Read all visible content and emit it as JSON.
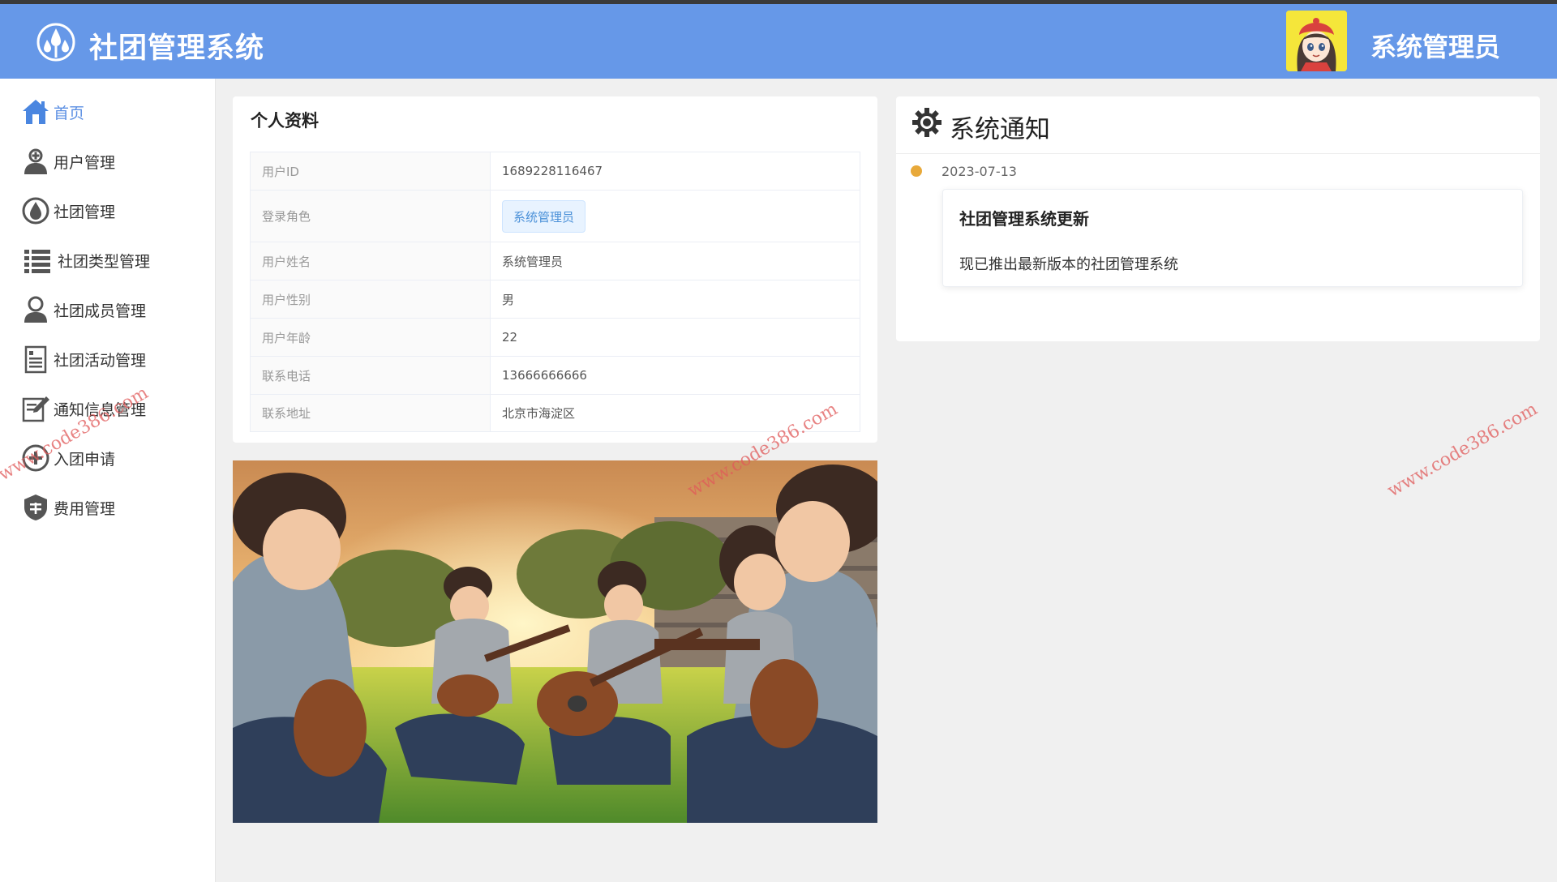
{
  "header": {
    "app_title": "社团管理系统",
    "user_name": "系统管理员",
    "logo_icon": "droplets-logo-icon",
    "avatar_icon": "cartoon-girl-avatar",
    "background_color": "#6698e8"
  },
  "sidebar": {
    "items": [
      {
        "label": "首页",
        "icon": "home-icon",
        "active": true
      },
      {
        "label": "用户管理",
        "icon": "user-icon"
      },
      {
        "label": "社团管理",
        "icon": "droplet-icon"
      },
      {
        "label": "社团类型管理",
        "icon": "list-icon"
      },
      {
        "label": "社团成员管理",
        "icon": "person-icon"
      },
      {
        "label": "社团活动管理",
        "icon": "clipboard-icon"
      },
      {
        "label": "通知信息管理",
        "icon": "edit-note-icon"
      },
      {
        "label": "入团申请",
        "icon": "plus-circle-icon"
      },
      {
        "label": "费用管理",
        "icon": "fee-shield-icon"
      }
    ],
    "active_color": "#5b8fe3"
  },
  "profile": {
    "title": "个人资料",
    "rows": [
      {
        "key": "用户ID",
        "value": "1689228116467"
      },
      {
        "key": "登录角色",
        "value": "系统管理员",
        "tag": true
      },
      {
        "key": "用户姓名",
        "value": "系统管理员"
      },
      {
        "key": "用户性别",
        "value": "男"
      },
      {
        "key": "用户年龄",
        "value": "22"
      },
      {
        "key": "联系电话",
        "value": "13666666666"
      },
      {
        "key": "联系地址",
        "value": "北京市海淀区"
      }
    ]
  },
  "notice": {
    "title": "系统通知",
    "icon": "gear-icon",
    "items": [
      {
        "date": "2023-07-13",
        "title": "社团管理系统更新",
        "body": "现已推出最新版本的社团管理系统"
      }
    ],
    "dot_color": "#e8a93a"
  },
  "watermark": "www.code386.com"
}
